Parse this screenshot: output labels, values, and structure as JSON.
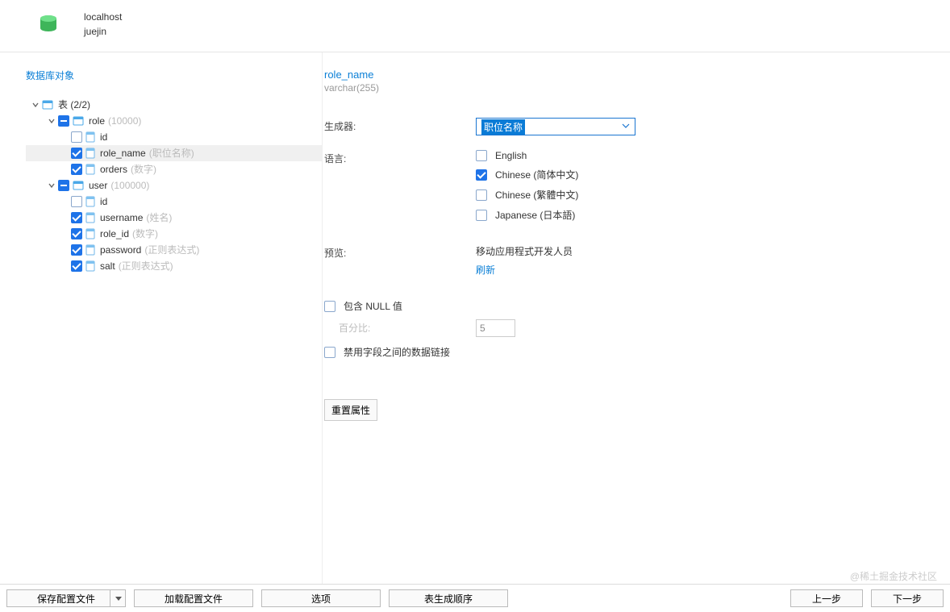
{
  "header": {
    "host": "localhost",
    "database": "juejin"
  },
  "left": {
    "title": "数据库对象",
    "tables_label": "表",
    "tables_count": "(2/2)",
    "tables": [
      {
        "name": "role",
        "count": "(10000)",
        "columns": [
          {
            "name": "id",
            "suffix": "",
            "checked": false
          },
          {
            "name": "role_name",
            "suffix": "(职位名称)",
            "checked": true,
            "selected": true
          },
          {
            "name": "orders",
            "suffix": "(数字)",
            "checked": true
          }
        ]
      },
      {
        "name": "user",
        "count": "(100000)",
        "columns": [
          {
            "name": "id",
            "suffix": "",
            "checked": false
          },
          {
            "name": "username",
            "suffix": "(姓名)",
            "checked": true
          },
          {
            "name": "role_id",
            "suffix": "(数字)",
            "checked": true
          },
          {
            "name": "password",
            "suffix": "(正则表达式)",
            "checked": true
          },
          {
            "name": "salt",
            "suffix": "(正则表达式)",
            "checked": true
          }
        ]
      }
    ]
  },
  "right": {
    "field_name": "role_name",
    "field_type": "varchar(255)",
    "generator_label": "生成器:",
    "generator_value": "职位名称",
    "language_label": "语言:",
    "languages": [
      {
        "label": "English",
        "checked": false
      },
      {
        "label": "Chinese (简体中文)",
        "checked": true
      },
      {
        "label": "Chinese (繁體中文)",
        "checked": false
      },
      {
        "label": "Japanese (日本語)",
        "checked": false
      }
    ],
    "preview_label": "预览:",
    "preview_value": "移动应用程式开发人员",
    "refresh_label": "刷新",
    "include_null_label": "包含 NULL 值",
    "percent_label": "百分比:",
    "percent_value": "5",
    "disable_link_label": "禁用字段之间的数据链接",
    "reset_label": "重置属性"
  },
  "footer": {
    "save_profile": "保存配置文件",
    "load_profile": "加载配置文件",
    "options": "选项",
    "table_order": "表生成顺序",
    "prev": "上一步",
    "next": "下一步"
  },
  "watermark": "@稀土掘金技术社区"
}
